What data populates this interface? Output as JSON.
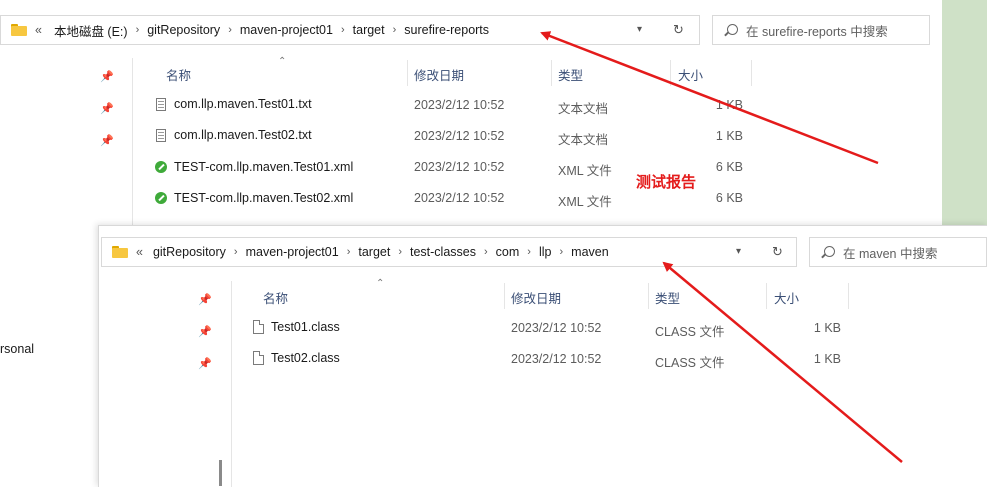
{
  "background_partial_text": "rsonal",
  "annotation_label": "测试报告",
  "colors": {
    "arrow": "#e41b1b",
    "header_text": "#3b4f76"
  },
  "window1": {
    "breadcrumb_overflow": "«",
    "breadcrumbs": [
      "本地磁盘 (E:)",
      "gitRepository",
      "maven-project01",
      "target",
      "surefire-reports"
    ],
    "dropdown_icon": "chevron-down-icon",
    "refresh_icon": "refresh-icon",
    "search_placeholder": "在 surefire-reports 中搜索",
    "columns": [
      "名称",
      "修改日期",
      "类型",
      "大小"
    ],
    "files": [
      {
        "name": "com.llp.maven.Test01.txt",
        "date": "2023/2/12 10:52",
        "type": "文本文档",
        "size": "1 KB",
        "icon": "text-file-icon"
      },
      {
        "name": "com.llp.maven.Test02.txt",
        "date": "2023/2/12 10:52",
        "type": "文本文档",
        "size": "1 KB",
        "icon": "text-file-icon"
      },
      {
        "name": "TEST-com.llp.maven.Test01.xml",
        "date": "2023/2/12 10:52",
        "type": "XML 文件",
        "size": "6 KB",
        "icon": "xml-file-icon"
      },
      {
        "name": "TEST-com.llp.maven.Test02.xml",
        "date": "2023/2/12 10:52",
        "type": "XML 文件",
        "size": "6 KB",
        "icon": "xml-file-icon"
      }
    ]
  },
  "window2": {
    "breadcrumb_overflow": "«",
    "breadcrumbs": [
      "gitRepository",
      "maven-project01",
      "target",
      "test-classes",
      "com",
      "llp",
      "maven"
    ],
    "search_placeholder": "在 maven 中搜索",
    "columns": [
      "名称",
      "修改日期",
      "类型",
      "大小"
    ],
    "files": [
      {
        "name": "Test01.class",
        "date": "2023/2/12 10:52",
        "type": "CLASS 文件",
        "size": "1 KB",
        "icon": "class-file-icon"
      },
      {
        "name": "Test02.class",
        "date": "2023/2/12 10:52",
        "type": "CLASS 文件",
        "size": "1 KB",
        "icon": "class-file-icon"
      }
    ]
  }
}
